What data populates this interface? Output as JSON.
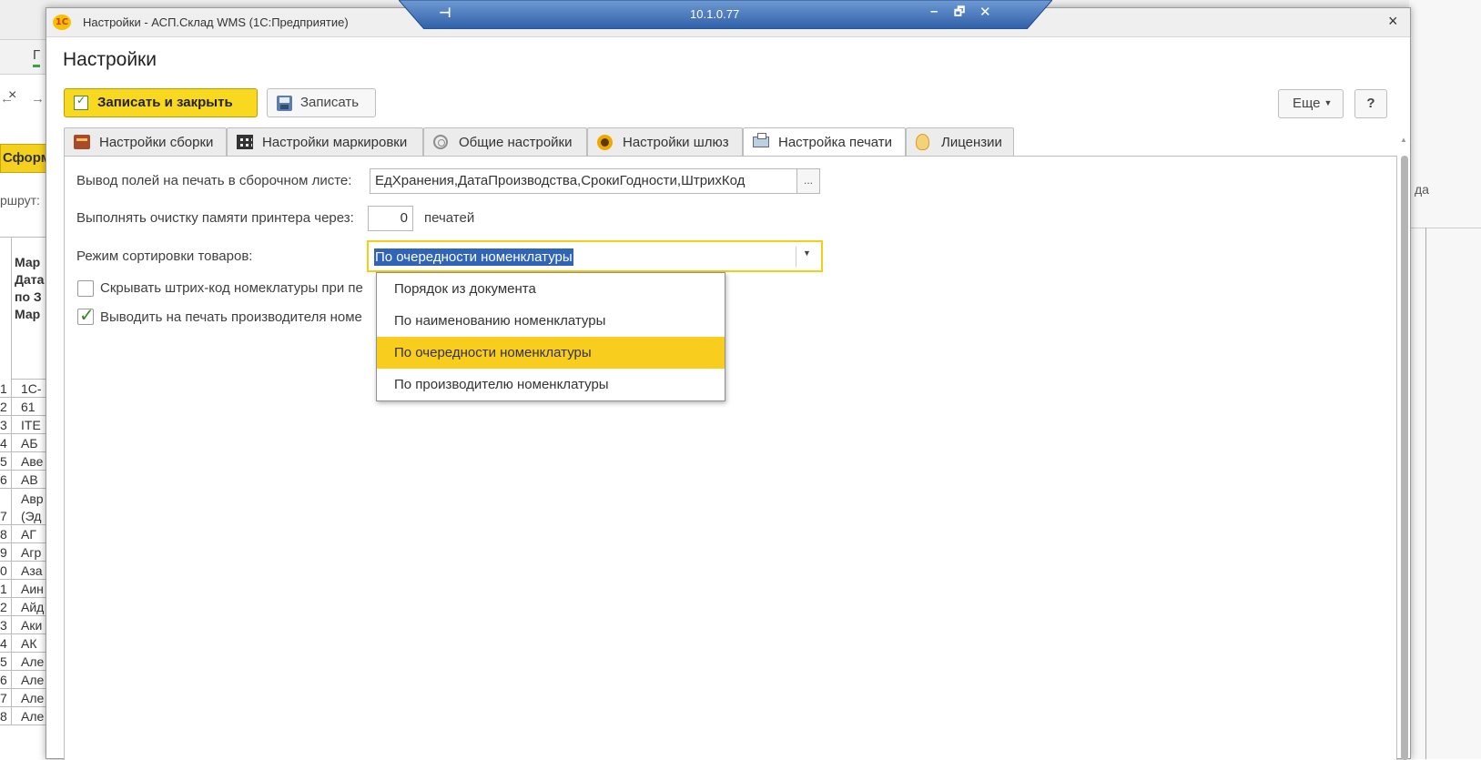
{
  "window": {
    "title": "Настройки - АСП.Склад WMS  (1С:Предприятие)",
    "close": "×",
    "logo": "1С"
  },
  "remote_bar": {
    "ip": "10.1.0.77",
    "pin": "⊣",
    "minimize": "–",
    "restore": "🗗",
    "close": "✕"
  },
  "form": {
    "title": "Настройки"
  },
  "toolbar": {
    "save_close": "Записать и закрыть",
    "save": "Записать",
    "more": "Еще",
    "help": "?"
  },
  "tabs": [
    {
      "label": "Настройки сборки",
      "icon": "assembly-icon"
    },
    {
      "label": "Настройки маркировки",
      "icon": "qr-code-icon"
    },
    {
      "label": "Общие настройки",
      "icon": "gear-icon"
    },
    {
      "label": "Настройки шлюз",
      "icon": "gateway-icon"
    },
    {
      "label": "Настройка печати",
      "icon": "printer-icon",
      "active": true
    },
    {
      "label": "Лицензии",
      "icon": "license-icon"
    }
  ],
  "print_settings": {
    "fields_label": "Вывод полей на печать в сборочном листе:",
    "fields_value": "ЕдХранения,ДатаПроизводства,СрокиГодности,ШтрихКод",
    "fields_button": "...",
    "clear_label": "Выполнять очистку памяти принтера через:",
    "clear_value": "0",
    "clear_unit": "печатей",
    "sort_label": "Режим сортировки товаров:",
    "sort_value": "По очередности номенклатуры",
    "hide_barcode_label": "Скрывать штрих-код номеклатуры при пе",
    "hide_barcode_checked": false,
    "print_manufacturer_label": "Выводить на печать производителя номе",
    "print_manufacturer_checked": true
  },
  "sort_options": [
    "Порядок из документа",
    "По наименованию номенклатуры",
    "По очередности номенклатуры",
    "По производителю номенклатуры"
  ],
  "sort_selected_index": 2,
  "background": {
    "tab_close": "×",
    "tab_letter": "Г",
    "nav_back": "←",
    "nav_forward": "→",
    "form_button": "Сформ",
    "route_label": "ршрут:",
    "right_text": "да",
    "header_lines": [
      "Мар",
      "Дата",
      "по З",
      "Мар"
    ],
    "rows": [
      {
        "n": "1",
        "text": "1С-"
      },
      {
        "n": "2",
        "text": "61"
      },
      {
        "n": "3",
        "text": "ITE"
      },
      {
        "n": "4",
        "text": "АБ"
      },
      {
        "n": "5",
        "text": "Аве"
      },
      {
        "n": "6",
        "text": "АВ"
      },
      {
        "n": "7",
        "text": "Авр (Эд"
      },
      {
        "n": "8",
        "text": "АГ"
      },
      {
        "n": "9",
        "text": "Агр"
      },
      {
        "n": "0",
        "text": "Аза"
      },
      {
        "n": "1",
        "text": "Аин"
      },
      {
        "n": "2",
        "text": "Айд"
      },
      {
        "n": "3",
        "text": "Аки"
      },
      {
        "n": "4",
        "text": "АК"
      },
      {
        "n": "5",
        "text": "Але"
      },
      {
        "n": "6",
        "text": "Але"
      },
      {
        "n": "7",
        "text": "Але"
      },
      {
        "n": "8",
        "text": "Але"
      }
    ]
  },
  "colors": {
    "accent_yellow": "#f8d920",
    "selection_blue": "#3064b9",
    "check_green": "#2f8a1a"
  }
}
